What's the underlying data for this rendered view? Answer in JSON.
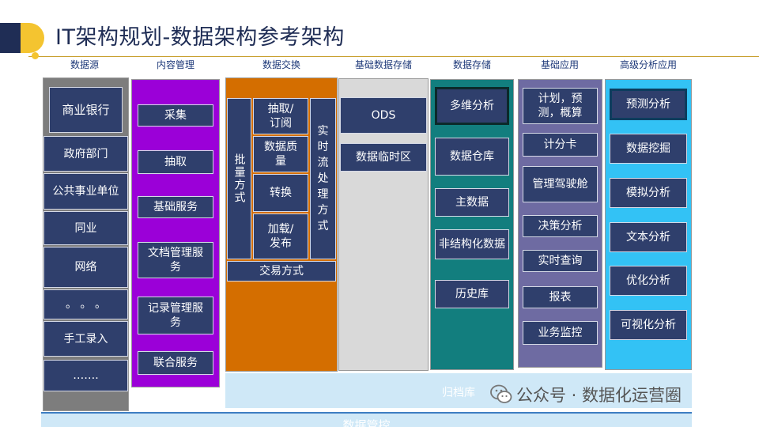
{
  "title": "IT架构规划-数据架构参考架构",
  "column_headers": [
    "数据源",
    "内容管理",
    "数据交换",
    "基础数据存储",
    "数据存储",
    "基础应用",
    "高级分析应用"
  ],
  "data_source": [
    "商业银行",
    "政府部门",
    "公共事业单位",
    "同业",
    "网络",
    "。 。 。",
    "手工录入",
    "……."
  ],
  "content_mgmt": [
    "采集",
    "抽取",
    "基础服务",
    "文档管理服务",
    "记录管理服务",
    "联合服务"
  ],
  "exchange": {
    "batch": "批量方式",
    "realtime": "实时流处理方式",
    "steps": [
      "抽取/订阅",
      "数据质量",
      "转换",
      "加载/发布"
    ],
    "transaction": "交易方式"
  },
  "base_storage": [
    "ODS",
    "数据临时区"
  ],
  "data_storage": [
    "多维分析",
    "数据仓库",
    "主数据",
    "非结构化数据",
    "历史库"
  ],
  "base_apps": [
    "计划，预测，概算",
    "计分卡",
    "管理驾驶舱",
    "决策分析",
    "实时查询",
    "报表",
    "业务监控"
  ],
  "adv_apps": [
    "预测分析",
    "数据挖掘",
    "模拟分析",
    "文本分析",
    "优化分析",
    "可视化分析"
  ],
  "archive": "归档库",
  "governance": "数据管控",
  "watermark": "公众号 · 数据化运营圈",
  "colors": {
    "navy": "#2f3f6c",
    "purple": "#9b00d8",
    "orange": "#d46e00",
    "teal": "#127e7e",
    "slate": "#6e6ba2",
    "cyan": "#33c2f5",
    "gold": "#f4c430"
  }
}
